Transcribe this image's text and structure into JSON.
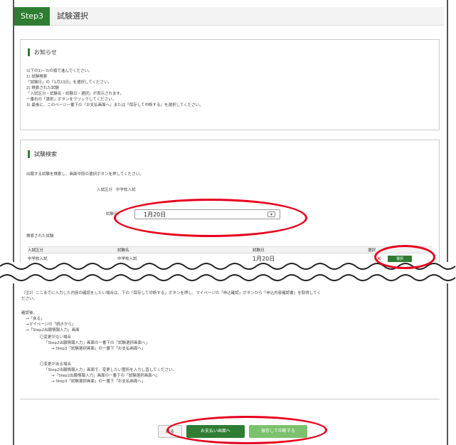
{
  "header": {
    "step_badge": "Step3",
    "title": "試験選択"
  },
  "notice": {
    "title": "お知らせ",
    "lines": [
      "以下の1)~3)の順で進んでください。",
      "1) 試験検索",
      "「試験日」の「1月23日」を選択してください。",
      "2) 検索された試験",
      "「入試区分・試験名・試験日・選択」が表示されます。",
      "一番右の「選択」ボタンをクリックしてください。",
      "3) 最後に、このページ一番下の『お支払画面へ』または『保存して中断する』を選択してください。"
    ]
  },
  "search": {
    "title": "試験検索",
    "instruction": "出願する試験を検索し、画面中段の選択ボタンを押してください。",
    "category_label": "入試区分",
    "category_value": "中学校入試",
    "date_label": "試験日",
    "date_value": "1月20日",
    "results_label": "検索された試験",
    "table_headers": [
      "入試区分",
      "試験名",
      "試験日",
      "選択"
    ],
    "table_row": {
      "category": "中学校入試",
      "name": "中学校入試",
      "date": "1月20日"
    },
    "select_button": "選択"
  },
  "notes": {
    "note2": "（注2）ここまでに入力した内容の確認をしたい場合は、下の「保存して中断する」ボタンを押し、マイページの「申込確認」ボタンから「申込内容確認書」を取得してく",
    "note2b": "ださい。",
    "confirm_lines": [
      "確認後、",
      "→「戻る」",
      "→マイページの「続きから」",
      "→「Step2出願情報入力」画面",
      "〇変更がない場合",
      "「Step2出願情報入力」画面の一番下の「試験選択画面へ」",
      "→ Step3「試験選択画面」の一番下「お支払画面へ」",
      "〇変更がある場合",
      "「Step2出願情報入力」画面で、変更したい箇所を入力し直してください。",
      "→「Step2出願情報入力」画面の一番下の「試験選択画面へ」",
      "→ Step3「試験選択画面」の一番下「お支払画面へ」"
    ]
  },
  "footer": {
    "back": "戻る",
    "pay": "お支払い画面へ",
    "save": "保存して中断する"
  },
  "colors": {
    "accent": "#2e7d32",
    "highlight": "#e8001c",
    "save_btn": "#7cc26e"
  }
}
